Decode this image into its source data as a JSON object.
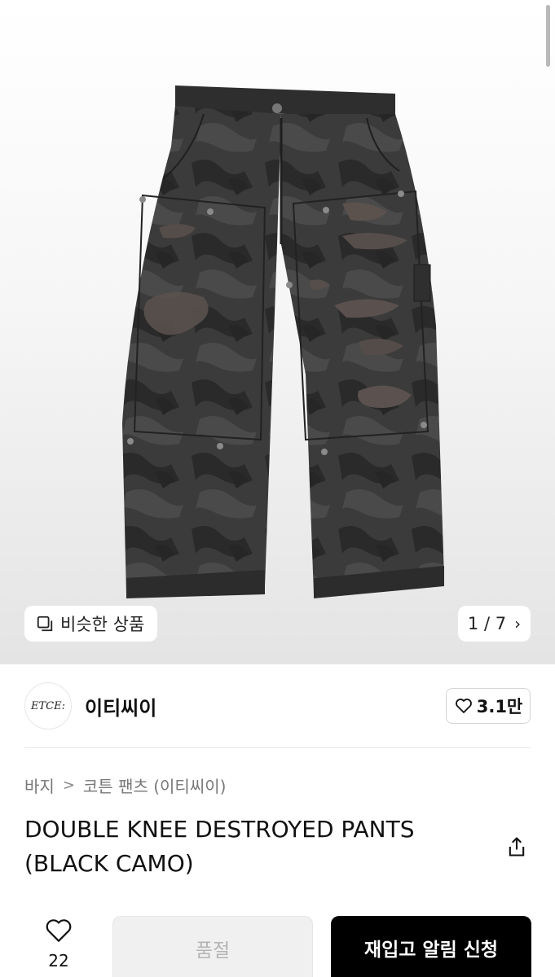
{
  "gallery": {
    "similar_label": "비슷한 상품",
    "counter": "1 / 7",
    "similar_icon": "copy-icon",
    "next_icon": "chevron-right-icon"
  },
  "brand": {
    "logo_text": "ETCE:",
    "name": "이티씨이",
    "likes": "3.1만",
    "like_icon": "heart-outline-icon"
  },
  "breadcrumb": {
    "items": [
      "바지",
      "코튼 팬츠 (이티씨이)"
    ],
    "separator": ">"
  },
  "product": {
    "title": "DOUBLE KNEE DESTROYED PANTS (BLACK CAMO)",
    "share_icon": "share-icon"
  },
  "bottom_bar": {
    "wish_count": "22",
    "soldout_label": "품절",
    "restock_label": "재입고 알림 신청"
  },
  "colors": {
    "primary_button": "#000000",
    "soldout_button": "#f0f0f0"
  }
}
